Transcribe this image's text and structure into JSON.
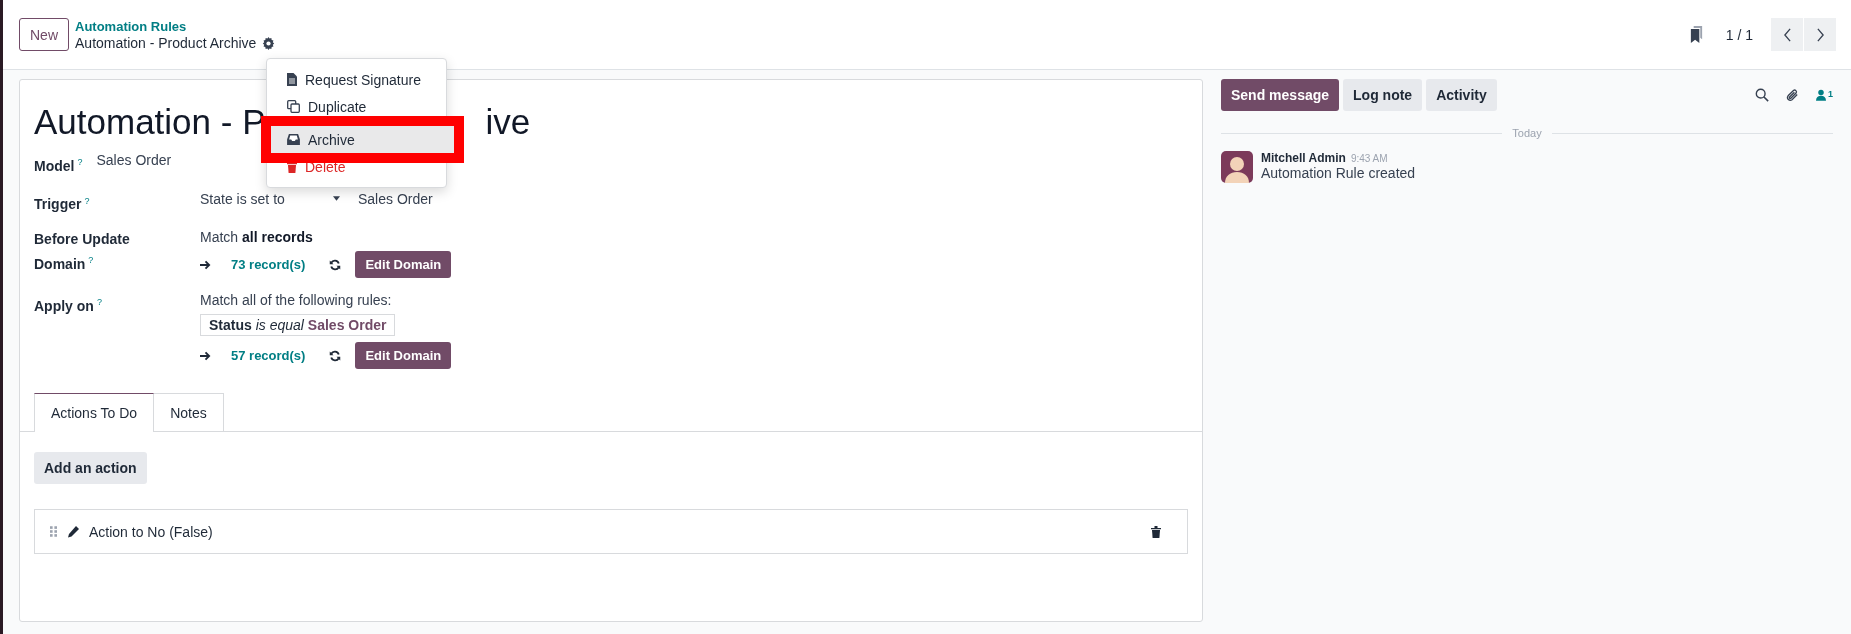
{
  "header": {
    "new_button": "New",
    "breadcrumb_parent": "Automation Rules",
    "breadcrumb_current": "Automation - Product Archive",
    "pager": "1 / 1"
  },
  "action_menu": {
    "items": [
      {
        "label": "Request Signature",
        "kind": "document",
        "selected": false
      },
      {
        "label": "Duplicate",
        "kind": "copy",
        "selected": false
      },
      {
        "label": "Archive",
        "kind": "archive",
        "selected": true
      },
      {
        "label": "Delete",
        "kind": "delete",
        "selected": false
      }
    ]
  },
  "form": {
    "title_parts": [
      "Automation - P",
      "ive"
    ],
    "fields": [
      {
        "label": "Model",
        "help": "?",
        "kind": "inline",
        "value": "Sales Order"
      },
      {
        "label": "Trigger",
        "help": "?",
        "kind": "select",
        "value": "State is set to",
        "extra": "Sales Order"
      },
      {
        "label": "Before Update Domain",
        "help": "?",
        "kind": "domain",
        "summary": "Match **all records**",
        "count": "73 record(s)",
        "button": "Edit Domain"
      },
      {
        "label": "Apply on",
        "help": "?",
        "kind": "domain",
        "summary": "Match all of the following rules:",
        "rule": {
          "field": "Status",
          "operator": "is equal",
          "value": "Sales Order"
        },
        "count": "57 record(s)",
        "button": "Edit Domain"
      }
    ],
    "tabs": [
      {
        "label": "Actions To Do",
        "selected": true
      },
      {
        "label": "Notes",
        "selected": false
      }
    ],
    "add_button": "Add an action",
    "actions": [
      {
        "label": "Action to No (False)"
      }
    ]
  },
  "chatter": {
    "buttons": [
      {
        "label": "Send message",
        "primary": true
      },
      {
        "label": "Log note",
        "primary": false
      },
      {
        "label": "Activity",
        "primary": false
      }
    ],
    "followers": "1",
    "separator": "Today",
    "messages": [
      {
        "author": "Mitchell Admin",
        "time": "9:43 AM",
        "body": "Automation Rule created"
      }
    ]
  }
}
